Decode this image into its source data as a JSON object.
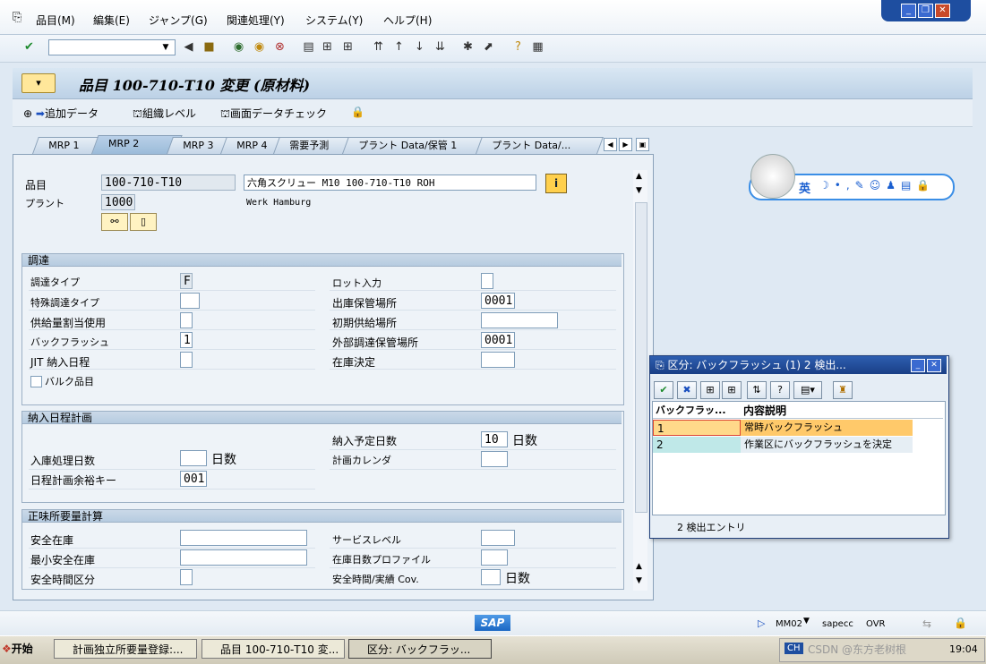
{
  "menu": {
    "items": [
      "品目(M)",
      "編集(E)",
      "ジャンプ(G)",
      "関連処理(Y)",
      "システム(Y)",
      "ヘルプ(H)"
    ]
  },
  "window_controls": {
    "minimize": "_",
    "restore": "❐",
    "close": "✕"
  },
  "toolbar": {
    "command_field": ""
  },
  "title": {
    "text": "品目 100-710-T10 変更 (原材料)"
  },
  "app_toolbar": {
    "add_data": "追加データ",
    "org_level": "組織レベル",
    "check_screen": "画面データチェック"
  },
  "tabs": [
    "MRP 1",
    "MRP 2",
    "MRP 3",
    "MRP 4",
    "需要予測",
    "プラント Data/保管 1",
    "プラント Data/..."
  ],
  "active_tab": "MRP 2",
  "header": {
    "material_label": "品目",
    "material_value": "100-710-T10",
    "material_desc": "六角スクリュー M10 100-710-T10 ROH",
    "plant_label": "プラント",
    "plant_value": "1000",
    "plant_desc": "Werk Hamburg"
  },
  "procurement": {
    "title": "調達",
    "proc_type_label": "調達タイプ",
    "proc_type_value": "F",
    "special_proc_label": "特殊調達タイプ",
    "special_proc_value": "",
    "quota_label": "供給量割当使用",
    "quota_value": "",
    "backflush_label": "バックフラッシュ",
    "backflush_value": "1",
    "jit_label": "JIT 納入日程",
    "jit_value": "",
    "bulk_label": "バルク品目",
    "batch_entry_label": "ロット入力",
    "batch_entry_value": "",
    "issue_sloc_label": "出庫保管場所",
    "issue_sloc_value": "0001",
    "default_supply_label": "初期供給場所",
    "default_supply_value": "",
    "ext_sloc_label": "外部調達保管場所",
    "ext_sloc_value": "0001",
    "stock_det_label": "在庫決定",
    "stock_det_value": ""
  },
  "scheduling": {
    "title": "納入日程計画",
    "gr_time_label": "入庫処理日数",
    "gr_time_value": "",
    "gr_time_unit": "日数",
    "sm_key_label": "日程計画余裕キー",
    "sm_key_value": "001",
    "pdt_label": "納入予定日数",
    "pdt_value": "10",
    "pdt_unit": "日数",
    "calendar_label": "計画カレンダ",
    "calendar_value": ""
  },
  "net_req": {
    "title": "正味所要量計算",
    "safety_stock_label": "安全在庫",
    "safety_stock_value": "",
    "min_safety_label": "最小安全在庫",
    "min_safety_value": "",
    "safety_time_ind_label": "安全時間区分",
    "safety_time_ind_value": "",
    "service_level_label": "サービスレベル",
    "service_level_value": "",
    "coverage_label": "在庫日数プロファイル",
    "coverage_value": "",
    "safety_time_label": "安全時間/実績 Cov.",
    "safety_time_value": "",
    "safety_time_unit": "日数"
  },
  "dialog": {
    "title": "区分: バックフラッシュ (1)    2 検出...",
    "col1": "バックフラッ...",
    "col2": "内容説明",
    "rows": [
      {
        "code": "1",
        "desc": "常時バックフラッシュ"
      },
      {
        "code": "2",
        "desc": "作業区にバックフラッシュを決定"
      }
    ],
    "footer": "2 検出エントリ"
  },
  "status": {
    "tcode": "MM02",
    "server": "sapecc",
    "mode": "OVR"
  },
  "taskbar": {
    "start": "开始",
    "tasks": [
      "計画独立所要量登録:...",
      "品目 100-710-T10 変...",
      "区分: バックフラッ..."
    ],
    "ime": "CH",
    "time": "19:04",
    "watermark": "CSDN @东方老树根"
  },
  "ime_bubble": {
    "lang": "英"
  },
  "colors": {
    "accent": "#1e4ea0",
    "selected_row": "#ffd98a",
    "row2": "#bfe8e8"
  }
}
